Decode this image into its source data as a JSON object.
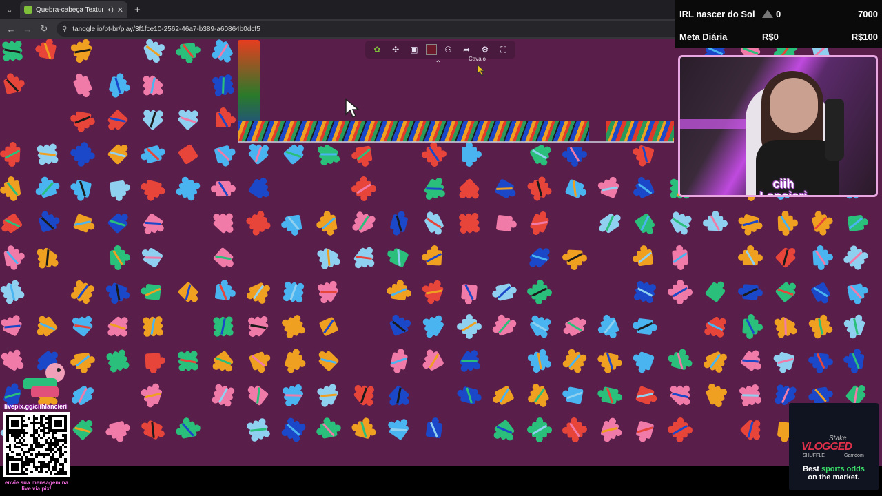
{
  "browser": {
    "tab_title": "Quebra-cabeça Textura",
    "url": "tanggle.io/pt-br/play/3f1fce10-2562-46a7-b389-a60864b0dcf5"
  },
  "toolbar": {
    "icons": [
      "tanggle-logo-icon",
      "puzzle-piece-icon",
      "image-icon",
      "color-swatch",
      "users-icon",
      "share-icon",
      "gear-icon",
      "fullscreen-icon"
    ],
    "label": "Cavalo"
  },
  "stats": {
    "row1_label": "IRL nascer do Sol",
    "row1_count": "0",
    "row1_goal": "7000",
    "row2_label": "Meta Diária",
    "row2_current": "R$0",
    "row2_goal": "R$100"
  },
  "webcam": {
    "name_line1": "ciih",
    "name_line2": "Lancieri"
  },
  "qr": {
    "title": "livepix.gg/ciihlancieri",
    "note": "envie sua mensagem na live via pix!"
  },
  "ad": {
    "brand_stake": "Stake",
    "brand_vlogged": "VLOGGED",
    "brand_shuffle": "SHUFFLE",
    "brand_gamdom": "Gamdom",
    "tagline_prefix": "Best",
    "tagline_highlight": "sports odds",
    "tagline_suffix": "on the market."
  },
  "colors": {
    "board_bg": "#5a1e4a",
    "piece_palette": [
      "#4ab4f0",
      "#f0a020",
      "#e8453a",
      "#2abf7a",
      "#f07aa8",
      "#1a48c8",
      "#8fd0f0",
      "#1a1a1a"
    ]
  }
}
